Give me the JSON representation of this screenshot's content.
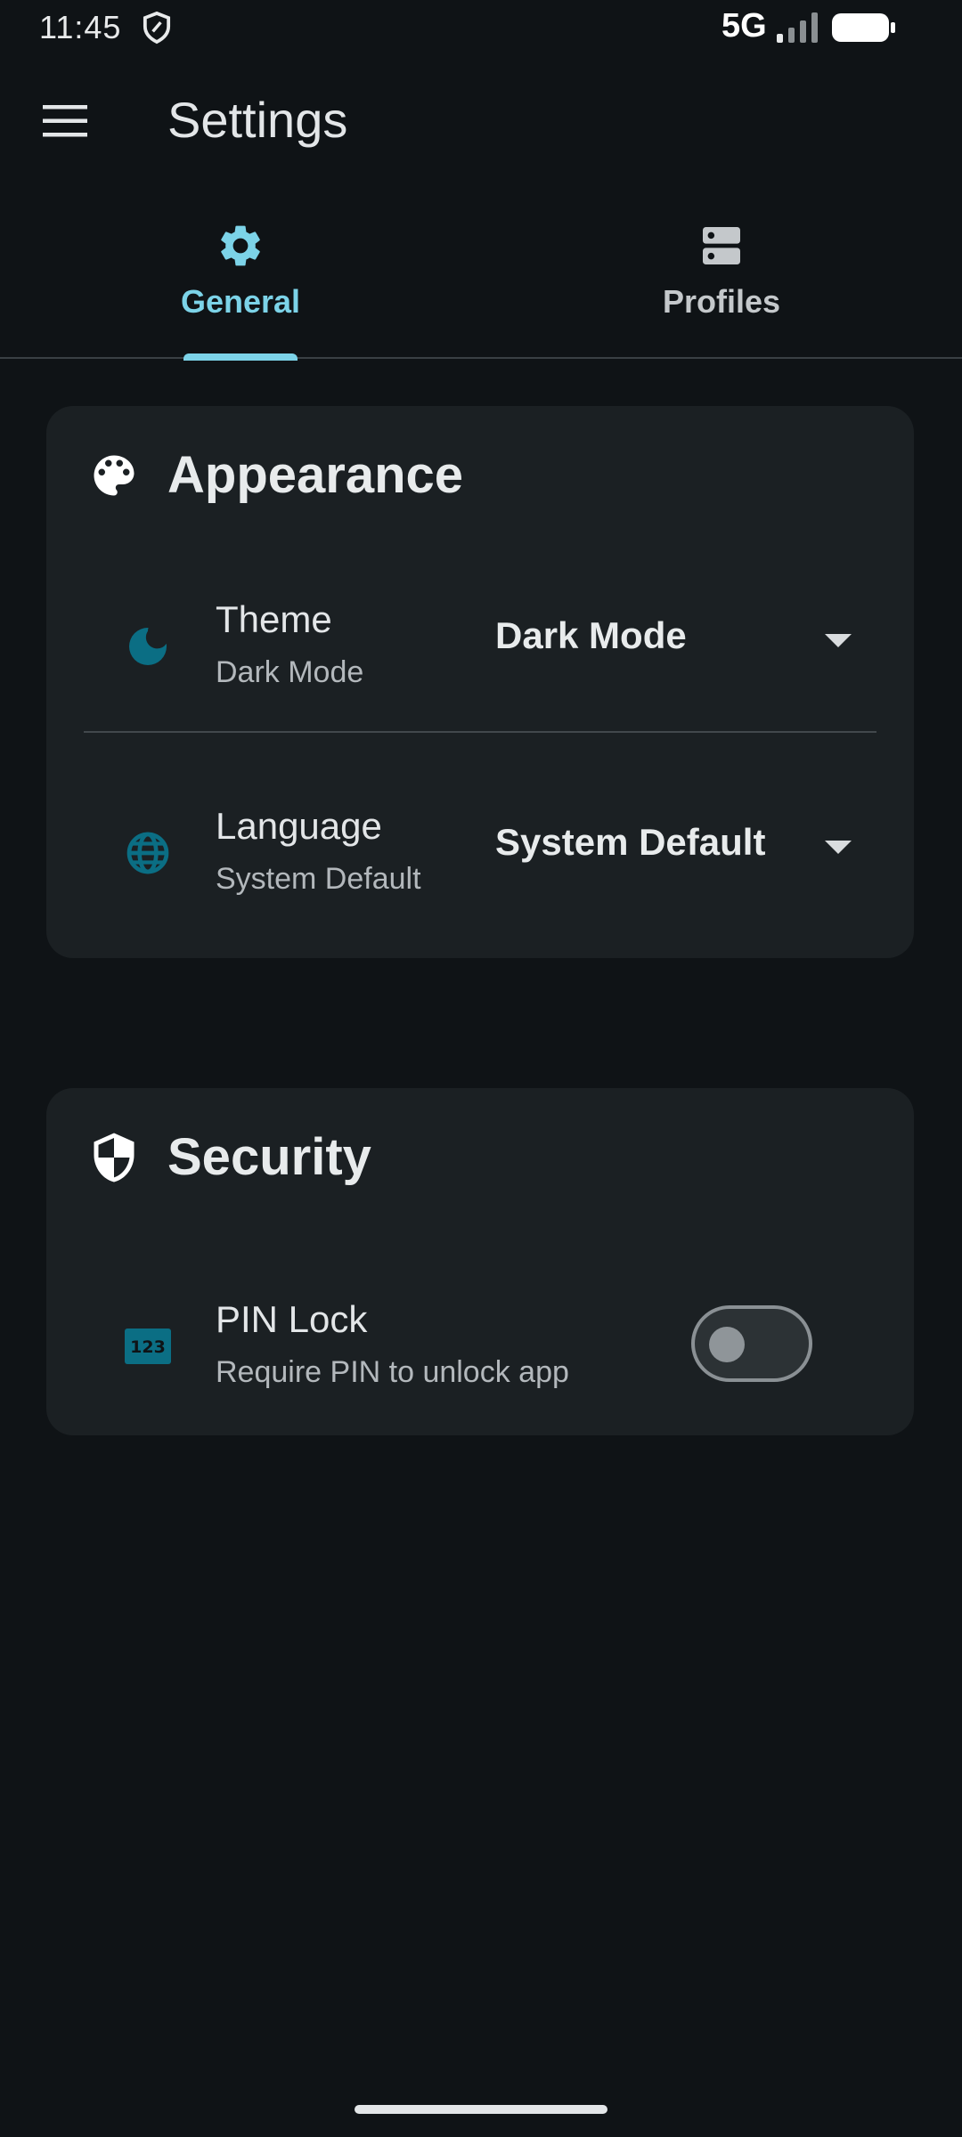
{
  "status_bar": {
    "time": "11:45",
    "network": "5G",
    "icons": [
      "shield-icon",
      "signal-icon",
      "battery-icon"
    ]
  },
  "app_bar": {
    "title": "Settings",
    "menu_icon": "menu-icon"
  },
  "tabs": [
    {
      "label": "General",
      "icon": "gear-icon",
      "selected": true
    },
    {
      "label": "Profiles",
      "icon": "dns-icon",
      "selected": false
    }
  ],
  "appearance": {
    "title": "Appearance",
    "icon": "palette-icon",
    "theme": {
      "title": "Theme",
      "subtitle": "Dark Mode",
      "value": "Dark Mode",
      "icon": "moon-icon"
    },
    "language": {
      "title": "Language",
      "subtitle": "System Default",
      "value": "System Default",
      "icon": "globe-icon"
    }
  },
  "security": {
    "title": "Security",
    "icon": "security-shield-icon",
    "pin_lock": {
      "title": "PIN Lock",
      "subtitle": "Require PIN to unlock app",
      "icon": "pin-123-icon",
      "enabled": false
    }
  },
  "colors": {
    "background": "#0f1316",
    "card": "#1b2023",
    "accent": "#7cd3e8",
    "icon_teal": "#0b6e84"
  }
}
